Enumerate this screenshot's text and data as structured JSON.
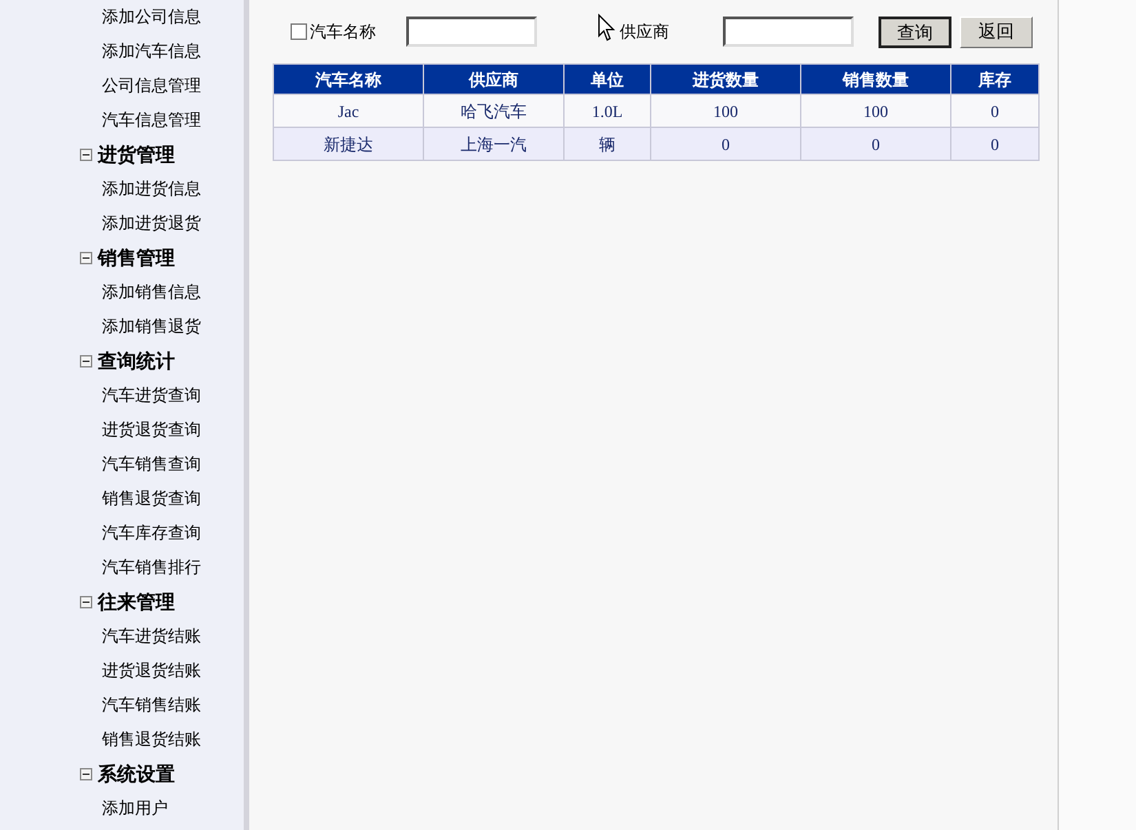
{
  "sidebar": {
    "items": [
      {
        "label": "添加公司信息"
      },
      {
        "label": "添加汽车信息"
      },
      {
        "label": "公司信息管理"
      },
      {
        "label": "汽车信息管理"
      }
    ],
    "groups": [
      {
        "label": "进货管理",
        "expanded": true,
        "children": [
          {
            "label": "添加进货信息"
          },
          {
            "label": "添加进货退货"
          }
        ]
      },
      {
        "label": "销售管理",
        "expanded": true,
        "children": [
          {
            "label": "添加销售信息"
          },
          {
            "label": "添加销售退货"
          }
        ]
      },
      {
        "label": "查询统计",
        "expanded": true,
        "children": [
          {
            "label": "汽车进货查询"
          },
          {
            "label": "进货退货查询"
          },
          {
            "label": "汽车销售查询"
          },
          {
            "label": "销售退货查询"
          },
          {
            "label": "汽车库存查询"
          },
          {
            "label": "汽车销售排行"
          }
        ]
      },
      {
        "label": "往来管理",
        "expanded": true,
        "children": [
          {
            "label": "汽车进货结账"
          },
          {
            "label": "进货退货结账"
          },
          {
            "label": "汽车销售结账"
          },
          {
            "label": "销售退货结账"
          }
        ]
      },
      {
        "label": "系统设置",
        "expanded": true,
        "children": [
          {
            "label": "添加用户"
          }
        ]
      }
    ]
  },
  "search": {
    "name_filter": {
      "label": "汽车名称",
      "checked": false
    },
    "supplier_label": "供应商",
    "buttons": [
      "查询",
      "返回"
    ]
  },
  "table": {
    "columns": [
      "汽车名称",
      "供应商",
      "单位",
      "进货数量",
      "销售数量",
      "库存"
    ],
    "rows": [
      [
        "Jac",
        "哈飞汽车",
        "1.0L",
        "100",
        "100",
        "0"
      ],
      [
        "新捷达",
        "上海一汽",
        "辆",
        "0",
        "0",
        "0"
      ]
    ]
  }
}
